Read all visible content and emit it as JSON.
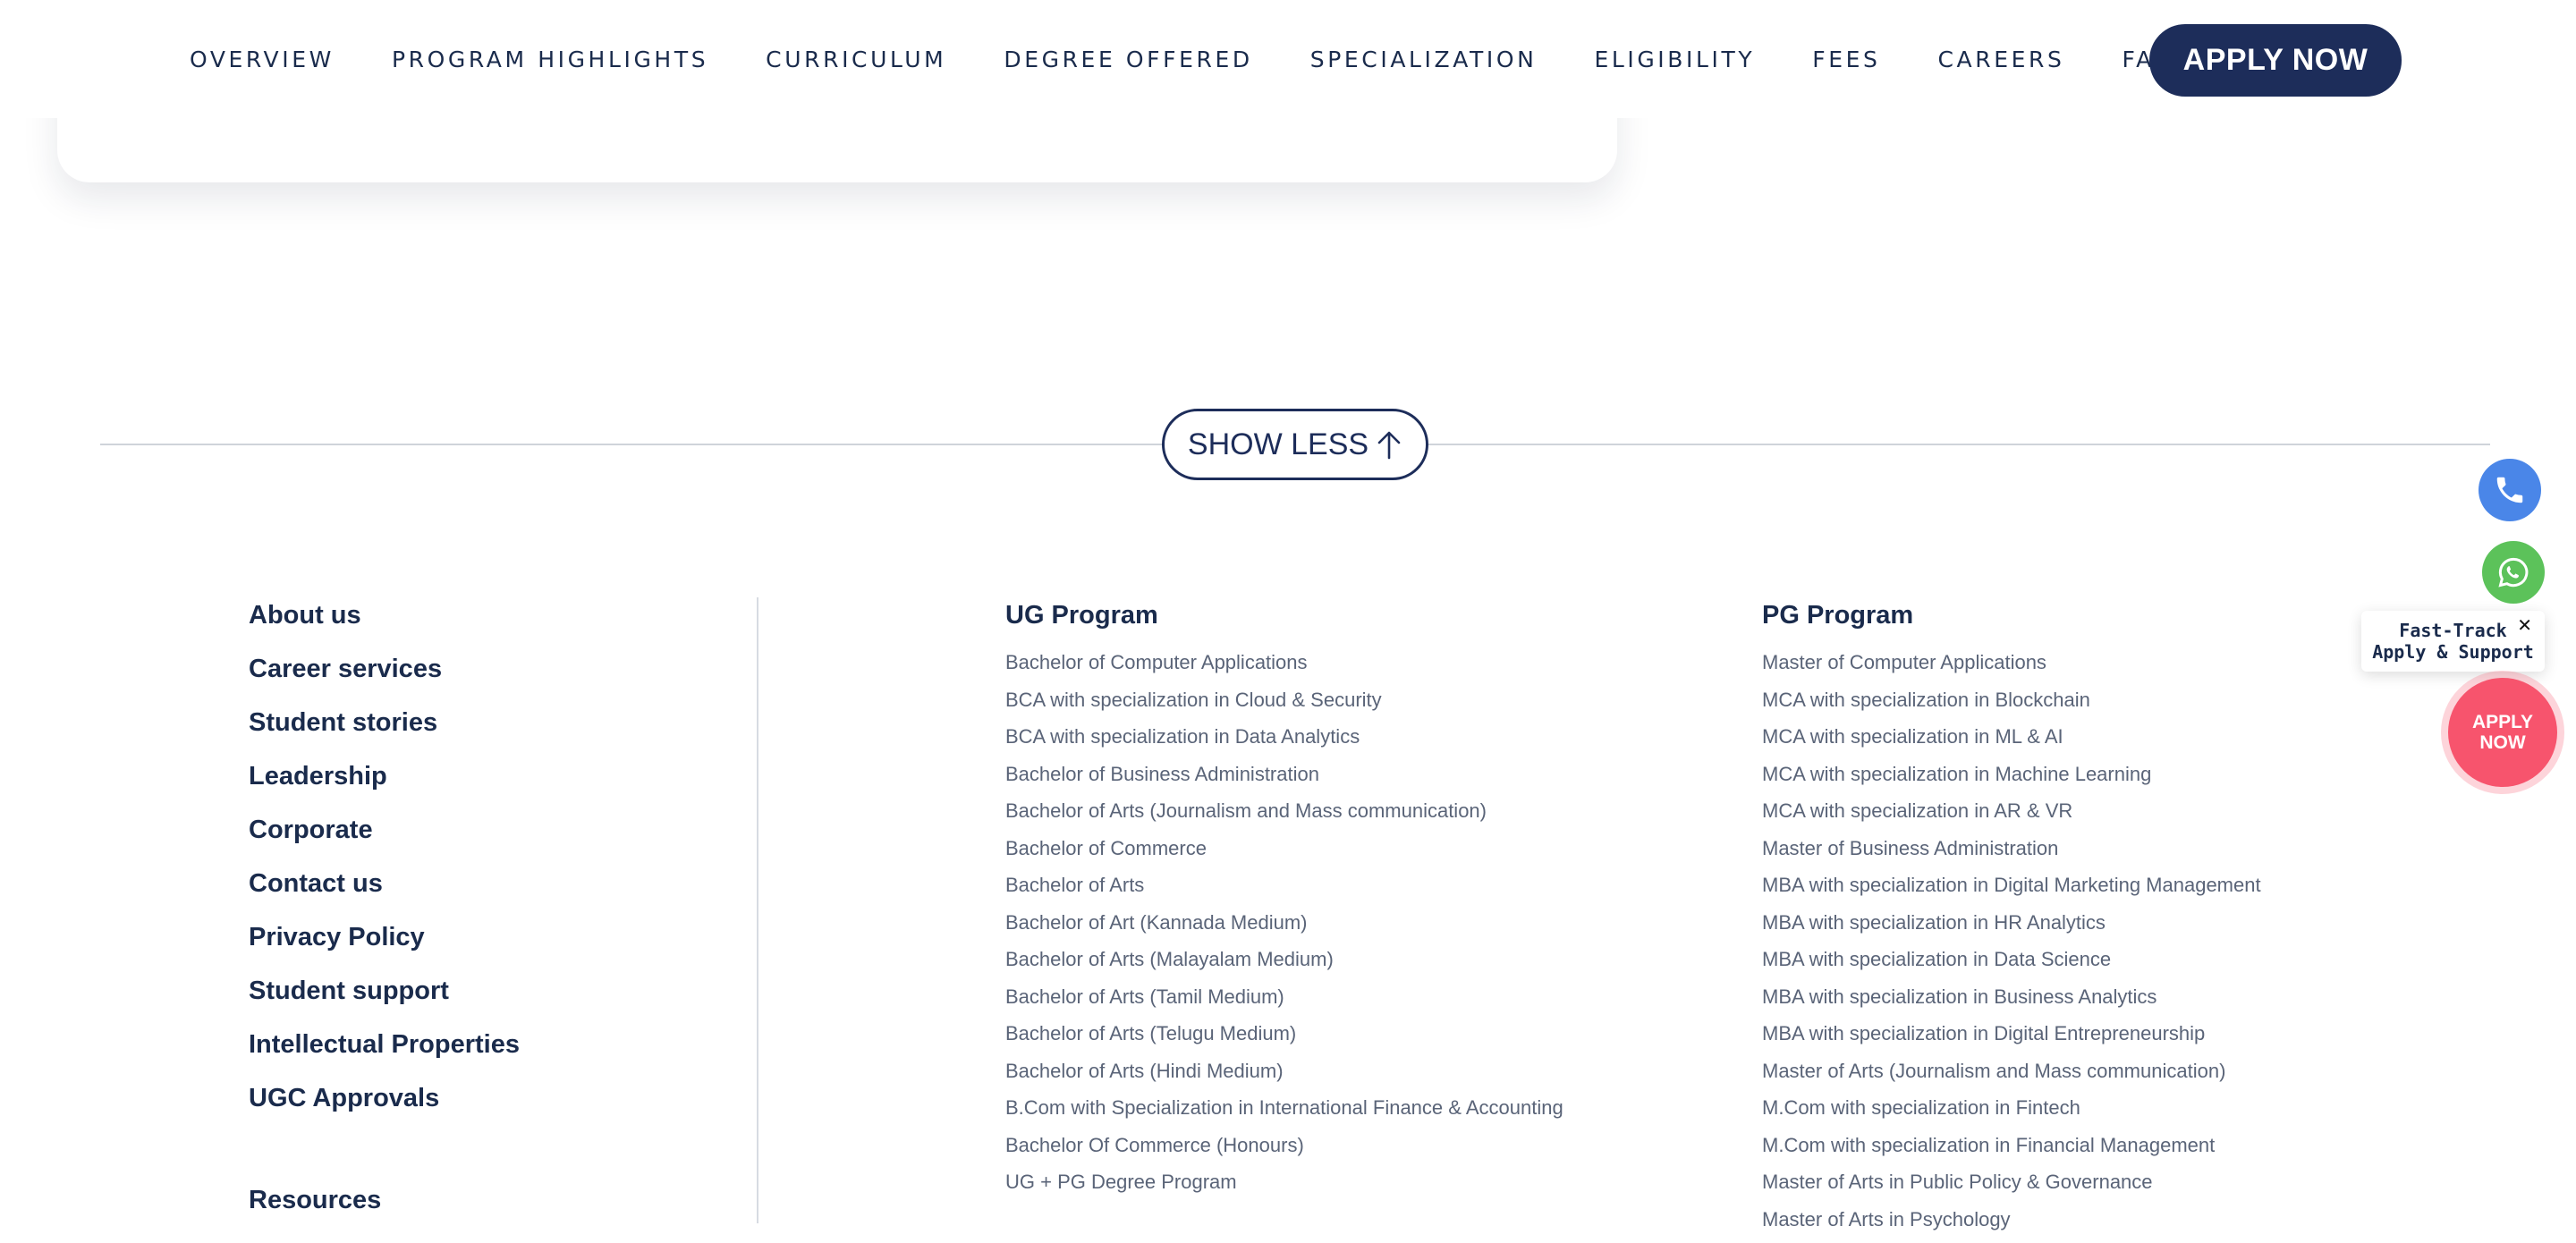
{
  "nav": {
    "items": [
      "OVERVIEW",
      "PROGRAM HIGHLIGHTS",
      "CURRICULUM",
      "DEGREE OFFERED",
      "SPECIALIZATION",
      "ELIGIBILITY",
      "FEES",
      "CAREERS",
      "FACULTY"
    ],
    "apply_label": "APPLY NOW"
  },
  "show_less": {
    "label": "SHOW LESS",
    "icon": "arrow-up-icon"
  },
  "footer": {
    "left_links": [
      "About us",
      "Career services",
      "Student stories",
      "Leadership",
      "Corporate",
      "Contact us",
      "Privacy Policy",
      "Student support",
      "Intellectual Properties",
      "UGC Approvals"
    ],
    "resources_label": "Resources",
    "ug": {
      "title": "UG Program",
      "items": [
        "Bachelor of Computer Applications",
        "BCA with specialization in Cloud & Security",
        "BCA with specialization in Data Analytics",
        "Bachelor of Business Administration",
        "Bachelor of Arts (Journalism and Mass communication)",
        "Bachelor of Commerce",
        "Bachelor of Arts",
        "Bachelor of Art (Kannada Medium)",
        "Bachelor of Arts (Malayalam Medium)",
        "Bachelor of Arts (Tamil Medium)",
        "Bachelor of Arts (Telugu Medium)",
        "Bachelor of Arts (Hindi Medium)",
        "B.Com with Specialization in International Finance & Accounting",
        "Bachelor Of Commerce (Honours)",
        "UG + PG Degree Program"
      ]
    },
    "pg": {
      "title": "PG Program",
      "items": [
        "Master of Computer Applications",
        "MCA with specialization in Blockchain",
        "MCA with specialization in ML & AI",
        "MCA with specialization in Machine Learning",
        "MCA with specialization in AR & VR",
        "Master of Business Administration",
        "MBA with specialization in Digital Marketing Management",
        "MBA with specialization in HR Analytics",
        "MBA with specialization in Data Science",
        "MBA with specialization in Business Analytics",
        "MBA with specialization in Digital Entrepreneurship",
        "Master of Arts (Journalism and Mass communication)",
        "M.Com with specialization in Fintech",
        "M.Com with specialization in Financial Management",
        "Master of Arts in Public Policy & Governance",
        "Master of Arts in Psychology"
      ]
    }
  },
  "floating": {
    "phone_icon": "phone-icon",
    "whatsapp_icon": "whatsapp-icon",
    "fast_track_line1": "Fast-Track",
    "fast_track_line2": "Apply & Support",
    "close_glyph": "✕",
    "apply_line1": "APPLY",
    "apply_line2": "NOW"
  },
  "colors": {
    "navy": "#1d2d5a",
    "apply_pink": "#f7546d",
    "phone_blue": "#4a86e8",
    "whatsapp_green": "#5cc25a"
  }
}
